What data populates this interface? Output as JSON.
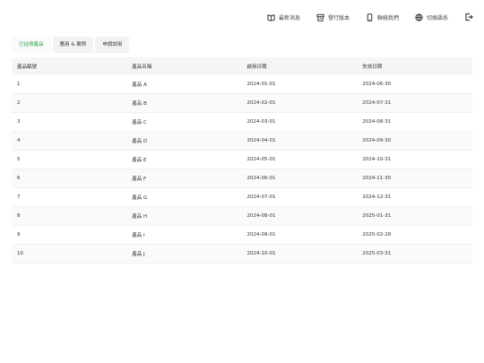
{
  "topbar": {
    "items": [
      {
        "label": "最新消息",
        "icon": "book-icon"
      },
      {
        "label": "發行版本",
        "icon": "archive-icon"
      },
      {
        "label": "聯絡我們",
        "icon": "phone-icon"
      },
      {
        "label": "切換語系",
        "icon": "globe-icon"
      }
    ],
    "logout_icon": "logout-icon"
  },
  "tabs": [
    {
      "label": "已註冊產品",
      "active": true
    },
    {
      "label": "應用 & 案例",
      "active": false
    },
    {
      "label": "申請試用",
      "active": false
    }
  ],
  "table": {
    "headers": [
      "產品編號",
      "產品名稱",
      "啟用日期",
      "失效日期"
    ],
    "rows": [
      [
        "1",
        "產品 A",
        "2024-01-01",
        "2024-06-30"
      ],
      [
        "2",
        "產品 B",
        "2024-02-01",
        "2024-07-31"
      ],
      [
        "3",
        "產品 C",
        "2024-03-01",
        "2024-08-31"
      ],
      [
        "4",
        "產品 D",
        "2024-04-01",
        "2024-09-30"
      ],
      [
        "5",
        "產品 E",
        "2024-05-01",
        "2024-10-31"
      ],
      [
        "6",
        "產品 F",
        "2024-06-01",
        "2024-11-30"
      ],
      [
        "7",
        "產品 G",
        "2024-07-01",
        "2024-12-31"
      ],
      [
        "8",
        "產品 H",
        "2024-08-01",
        "2025-01-31"
      ],
      [
        "9",
        "產品 I",
        "2024-09-01",
        "2025-02-28"
      ],
      [
        "10",
        "產品 J",
        "2024-10-01",
        "2025-03-31"
      ]
    ]
  },
  "colors": {
    "accent": "#25a244",
    "header_bg": "#f5f5f5",
    "alt_row_bg": "#fafafa"
  }
}
